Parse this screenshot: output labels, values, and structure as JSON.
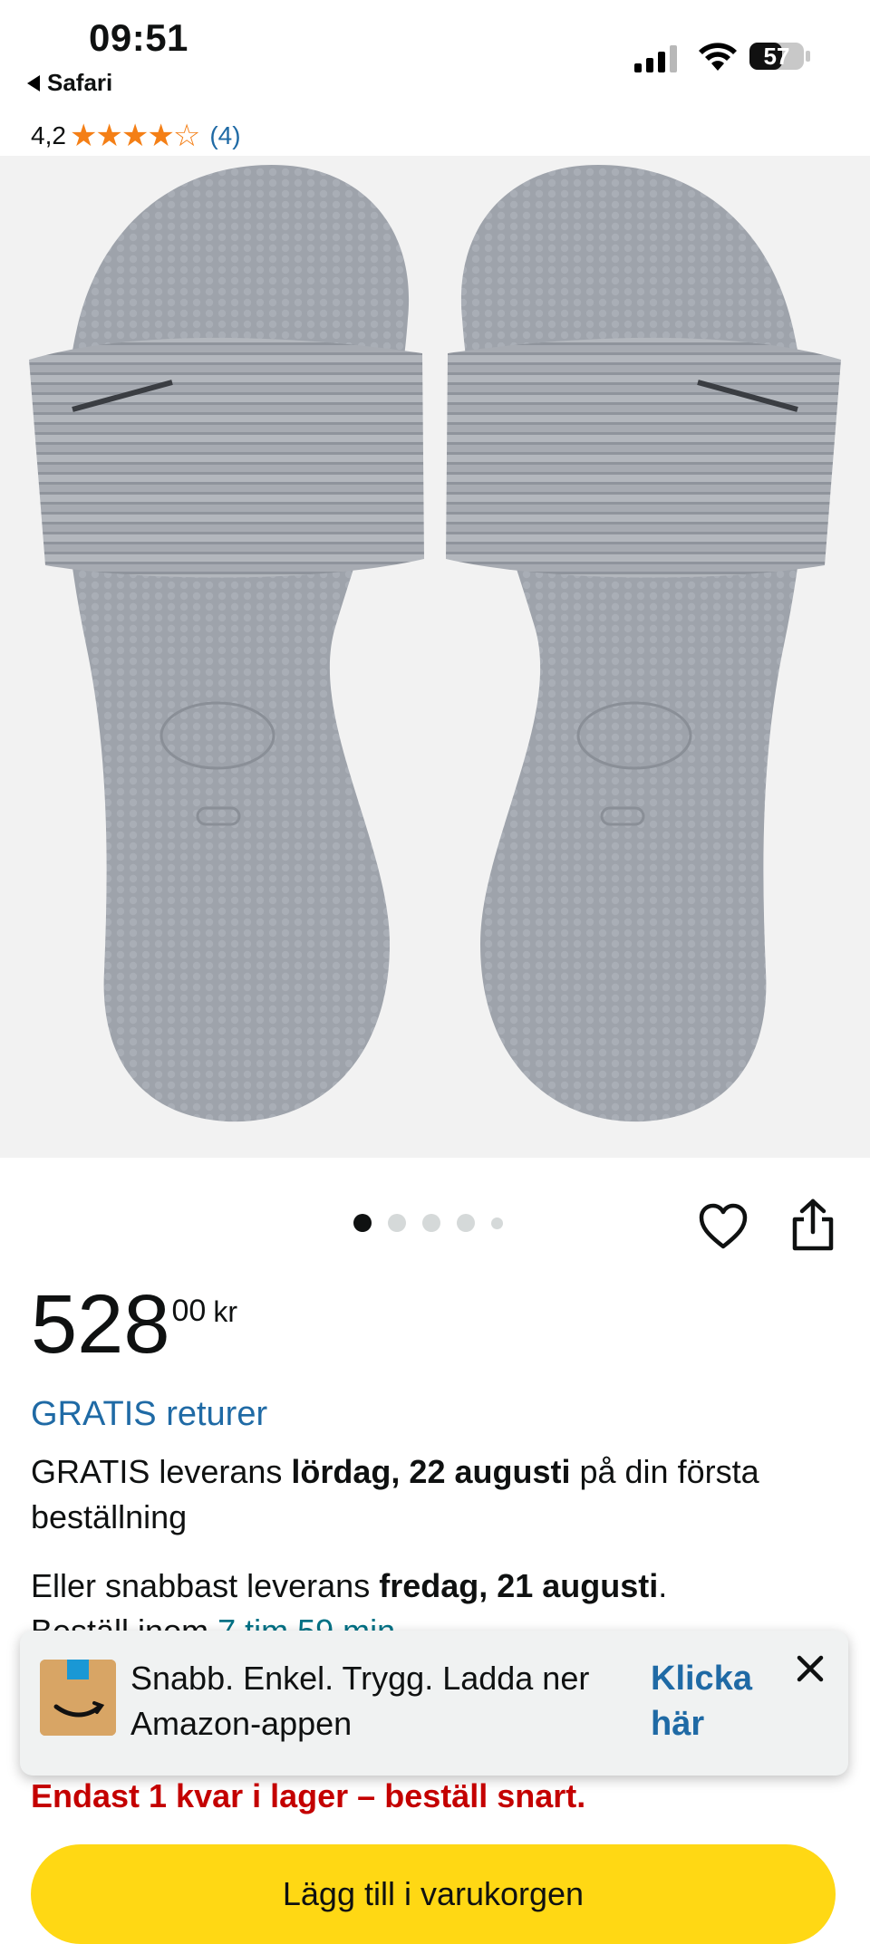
{
  "status_bar": {
    "time": "09:51",
    "back_app": "Safari",
    "battery": "57"
  },
  "rating": {
    "value": "4,2",
    "stars": "★★★★☆",
    "count": "(4)",
    "star_color": "#f47f16"
  },
  "gallery": {
    "image_count": 5,
    "active_index": 0
  },
  "price": {
    "whole": "528",
    "fraction": "00",
    "currency": "kr"
  },
  "free_returns": "GRATIS returer",
  "delivery": {
    "prefix": "GRATIS leverans ",
    "date": "lördag, 22 augusti",
    "suffix": " på din första beställning"
  },
  "fastest": {
    "prefix": "Eller snabbast leverans ",
    "date": "fredag, 21 augusti",
    "suffix": ".",
    "order_within_prefix": "Beställ inom ",
    "order_within_time": "7 tim 59 min"
  },
  "app_banner": {
    "text": "Snabb. Enkel. Trygg. Ladda ner Amazon-appen",
    "cta": "Klicka här"
  },
  "stock": "Endast 1 kvar i lager – beställ snart.",
  "cart_button": "Lägg till i varukorgen",
  "colors": {
    "link": "#1f6aa5",
    "alert": "#c40000",
    "button": "#ffd814"
  }
}
